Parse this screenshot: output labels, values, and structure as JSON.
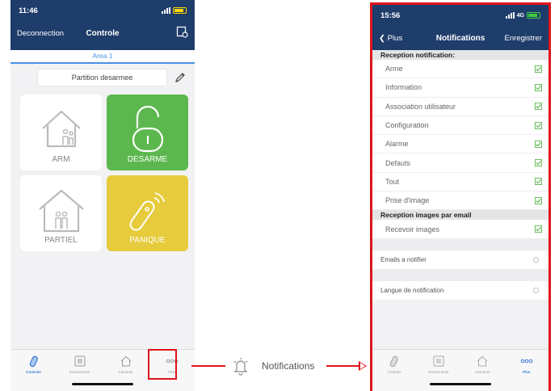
{
  "left_phone": {
    "status": {
      "time": "11:46",
      "network": ""
    },
    "nav": {
      "left": "Deconnection",
      "title": "Controle"
    },
    "area_tab": "Area 1",
    "partition": "Partition desarmee",
    "tiles": [
      {
        "label": "ARM",
        "icon": "house-people-icon"
      },
      {
        "label": "DESARME",
        "icon": "padlock-open-icon"
      },
      {
        "label": "PARTIEL",
        "icon": "house-family-icon"
      },
      {
        "label": "PANIQUE",
        "icon": "remote-control-icon"
      }
    ],
    "tabs": [
      {
        "label": "Controle",
        "active": true
      },
      {
        "label": "Evenements",
        "active": false
      },
      {
        "label": "Cameras",
        "active": false
      },
      {
        "label": "Plus",
        "active": false
      }
    ]
  },
  "connector": {
    "label": "Notifications",
    "icon": "bell-icon"
  },
  "right_phone": {
    "status": {
      "time": "15:56",
      "network": "4G"
    },
    "nav": {
      "back": "Plus",
      "title": "Notifications",
      "action": "Enregistrer"
    },
    "section_reception": "Reception notification:",
    "reception_items": [
      "Arme",
      "Information",
      "Association utilisateur",
      "Configuration",
      "Alarme",
      "Defauts",
      "Tout",
      "Prise d'image"
    ],
    "section_email": "Reception images par email",
    "email_items": [
      "Recevoir images"
    ],
    "emails_row": "Emails a notifier",
    "language_row": "Langue de notification",
    "tabs": [
      {
        "label": "Controle",
        "active": false
      },
      {
        "label": "Evenements",
        "active": false
      },
      {
        "label": "Cameras",
        "active": false
      },
      {
        "label": "Plus",
        "active": true
      }
    ]
  },
  "colors": {
    "header": "#1f3d6b",
    "accent_red": "#e0141c",
    "tile_green": "#5cb84e",
    "tile_yellow": "#e6cb3c",
    "check_green": "#5cb84e",
    "tab_active": "#3a7bd5"
  }
}
